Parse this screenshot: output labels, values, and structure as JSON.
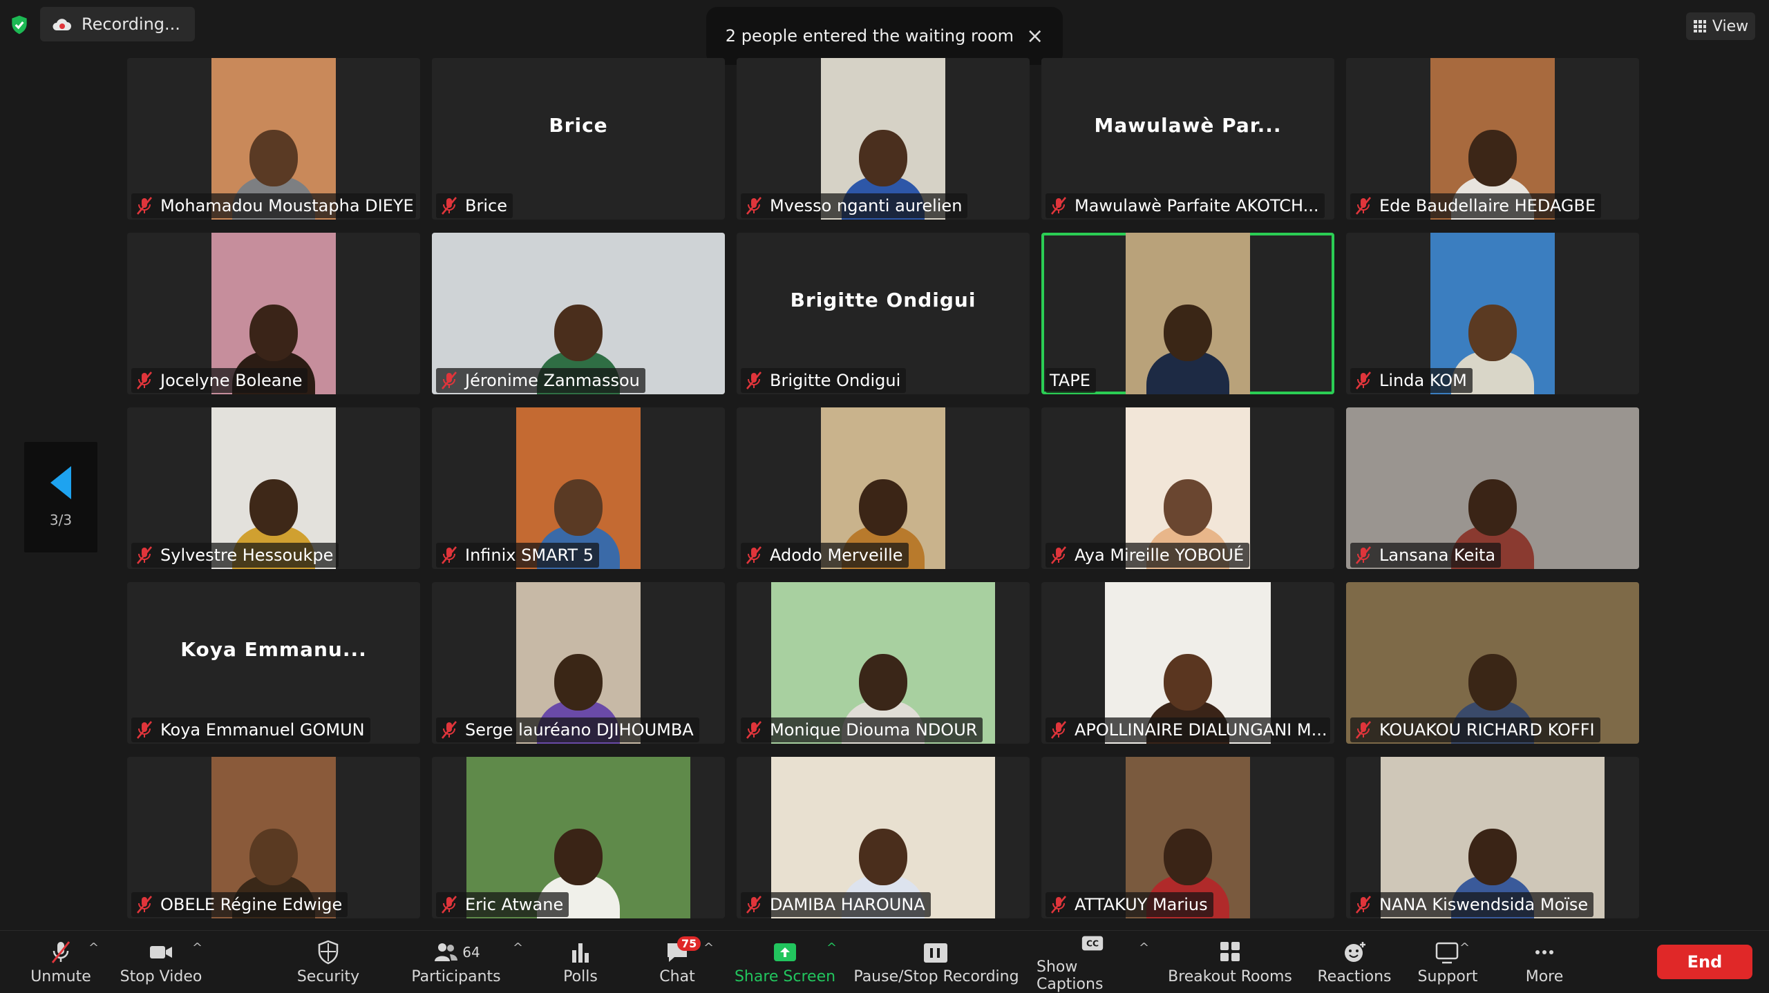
{
  "top": {
    "recording_label": "Recording...",
    "view_label": "View",
    "toast_text": "2 people entered the waiting room"
  },
  "page_indicator": "3/3",
  "participants": [
    {
      "name": "Mohamadou Moustapha DIEYE",
      "display": "",
      "muted": true,
      "video": "portrait",
      "bg": "#c9895a",
      "skin": "#5a3a24",
      "shirt": "#7d7f82"
    },
    {
      "name": "Brice",
      "display": "Brice",
      "muted": true,
      "video": "none"
    },
    {
      "name": "Mvesso nganti aurelien",
      "display": "",
      "muted": true,
      "video": "portrait",
      "bg": "#d6d2c6",
      "skin": "#4a2f1e",
      "shirt": "#2d57a8"
    },
    {
      "name": "Mawulawè Parfaite AKOTCH...",
      "display": "Mawulawè Par...",
      "muted": true,
      "video": "none"
    },
    {
      "name": "Ede Baudellaire HEDAGBE",
      "display": "",
      "muted": true,
      "video": "portrait",
      "bg": "#a86a3e",
      "skin": "#3c2617",
      "shirt": "#e8e4de"
    },
    {
      "name": "Jocelyne Boleane",
      "display": "",
      "muted": true,
      "video": "portrait",
      "bg": "#c68e9c",
      "skin": "#3a2418",
      "shirt": "#2b1c14"
    },
    {
      "name": "Jéronime Zanmassou",
      "display": "",
      "muted": true,
      "video": "full",
      "bg": "#cfd3d6",
      "skin": "#4a2e1c",
      "shirt": "#2f6e44"
    },
    {
      "name": "Brigitte Ondigui",
      "display": "Brigitte Ondigui",
      "muted": true,
      "video": "none"
    },
    {
      "name": "TAPE",
      "display": "",
      "muted": false,
      "video": "portrait",
      "bg": "#b9a27a",
      "skin": "#3a2616",
      "shirt": "#1d2a44",
      "active": true
    },
    {
      "name": "Linda KOM",
      "display": "",
      "muted": true,
      "video": "portrait",
      "bg": "#3b7ec0",
      "skin": "#5b3a22",
      "shirt": "#d9d6c8"
    },
    {
      "name": "Sylvestre Hessoukpe",
      "display": "",
      "muted": true,
      "video": "portrait",
      "bg": "#e3e1dc",
      "skin": "#3e2818",
      "shirt": "#d0a030"
    },
    {
      "name": "Infinix SMART 5",
      "display": "",
      "muted": true,
      "video": "portrait",
      "bg": "#c46a32",
      "skin": "#5a3a24",
      "shirt": "#3a6aa8"
    },
    {
      "name": "Adodo Merveille",
      "display": "",
      "muted": true,
      "video": "portrait",
      "bg": "#c9b38c",
      "skin": "#3b2516",
      "shirt": "#b87a2c"
    },
    {
      "name": "Aya Mireille YOBOUÉ",
      "display": "",
      "muted": true,
      "video": "portrait",
      "bg": "#f2e6d8",
      "skin": "#6a4630",
      "shirt": "#e8b68a"
    },
    {
      "name": "Lansana Keita",
      "display": "",
      "muted": true,
      "video": "full",
      "bg": "#9a9590",
      "skin": "#3a2416",
      "shirt": "#8a3a30"
    },
    {
      "name": "Koya Emmanuel GOMUN",
      "display": "Koya Emmanu...",
      "muted": true,
      "video": "none"
    },
    {
      "name": "Serge lauréano DJIHOUMBA",
      "display": "",
      "muted": true,
      "video": "portrait",
      "bg": "#c7b9a6",
      "skin": "#3a2616",
      "shirt": "#6a4aa8"
    },
    {
      "name": "Monique Diouma NDOUR",
      "display": "",
      "muted": true,
      "video": "wide",
      "bg": "#a8d0a0",
      "skin": "#3a2618",
      "shirt": "#e0ddd6"
    },
    {
      "name": "APOLLINAIRE DIALUNGANI M...",
      "display": "",
      "muted": true,
      "video": "m",
      "bg": "#f0eee9",
      "skin": "#5a3620",
      "shirt": "#3a2418"
    },
    {
      "name": "KOUAKOU RICHARD KOFFI",
      "display": "",
      "muted": true,
      "video": "full",
      "bg": "#7e6a48",
      "skin": "#3a2616",
      "shirt": "#3a4a6a"
    },
    {
      "name": "OBELE Régine Edwige",
      "display": "",
      "muted": true,
      "video": "portrait",
      "bg": "#8a5a3a",
      "skin": "#5a3a22",
      "shirt": "#3a2818"
    },
    {
      "name": "Eric Atwane",
      "display": "",
      "muted": true,
      "video": "wide",
      "bg": "#5f8a4a",
      "skin": "#3a2416",
      "shirt": "#f0f0ea"
    },
    {
      "name": "DAMIBA HAROUNA",
      "display": "",
      "muted": true,
      "video": "wide",
      "bg": "#e8e0d0",
      "skin": "#4a2e1c",
      "shirt": "#dde3ee"
    },
    {
      "name": "ATTAKUY Marius",
      "display": "",
      "muted": true,
      "video": "portrait",
      "bg": "#7a5a3e",
      "skin": "#3a2416",
      "shirt": "#b02a2a"
    },
    {
      "name": "NANA Kiswendsida Moïse",
      "display": "",
      "muted": true,
      "video": "wide",
      "bg": "#cfc7b8",
      "skin": "#3a2416",
      "shirt": "#3a5a9a"
    }
  ],
  "toolbar": {
    "unmute": "Unmute",
    "stop_video": "Stop Video",
    "security": "Security",
    "participants": "Participants",
    "participants_count": "64",
    "polls": "Polls",
    "chat": "Chat",
    "chat_badge": "75",
    "share_screen": "Share Screen",
    "recording": "Pause/Stop Recording",
    "captions": "Show Captions",
    "breakout": "Breakout Rooms",
    "reactions": "Reactions",
    "support": "Support",
    "more": "More",
    "end": "End"
  },
  "colors": {
    "share_green": "#22c55e",
    "active_border": "#2bcd54",
    "end_red": "#e02828",
    "mute_red": "#e0353b",
    "accent_blue": "#1ea3f0"
  }
}
